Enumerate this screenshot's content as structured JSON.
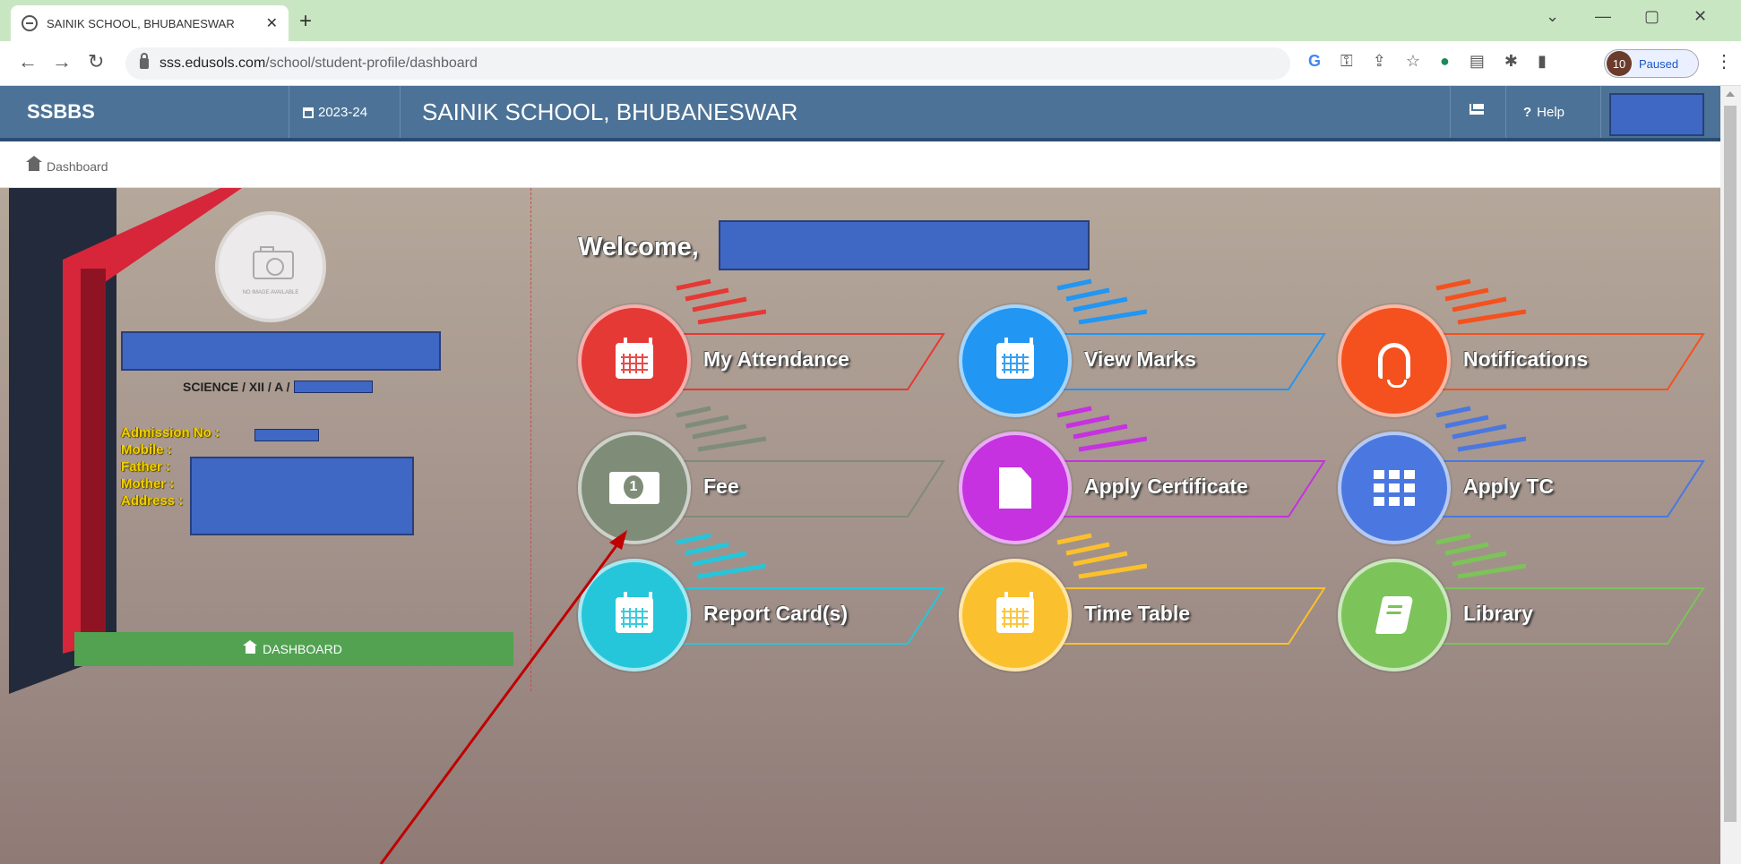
{
  "browser": {
    "tab_title": "SAINIK SCHOOL, BHUBANESWAR",
    "new_tab": "+",
    "url_host": "sss.edusols.com",
    "url_path": "/school/student-profile/dashboard",
    "profile_count": "10",
    "profile_status": "Paused"
  },
  "header": {
    "brand": "SSBBS",
    "session": "2023-24",
    "school_name": "SAINIK SCHOOL, BHUBANESWAR",
    "help": "Help"
  },
  "breadcrumb": {
    "label": "Dashboard"
  },
  "profile": {
    "photo_text": "NO IMAGE AVAILABLE",
    "class_line": "SCIENCE / XII / A /",
    "admission_label": "Admission No :",
    "mobile_label": "Mobile :",
    "father_label": "Father :",
    "mother_label": "Mother :",
    "address_label": "Address :",
    "dashboard_button": "DASHBOARD"
  },
  "welcome": "Welcome,",
  "tiles": [
    {
      "label": "My Attendance",
      "icon": "calendar-icon",
      "color": "#e53935"
    },
    {
      "label": "View Marks",
      "icon": "calendar-icon",
      "color": "#2196f3"
    },
    {
      "label": "Notifications",
      "icon": "bell-icon",
      "color": "#f4511e"
    },
    {
      "label": "Fee",
      "icon": "money-icon",
      "color": "#7f8c78"
    },
    {
      "label": "Apply Certificate",
      "icon": "document-icon",
      "color": "#c631e0"
    },
    {
      "label": "Apply TC",
      "icon": "grid-icon",
      "color": "#4a78e0"
    },
    {
      "label": "Report Card(s)",
      "icon": "calendar-icon",
      "color": "#26c6da"
    },
    {
      "label": "Time Table",
      "icon": "calendar-icon",
      "color": "#fbc02d"
    },
    {
      "label": "Library",
      "icon": "book-icon",
      "color": "#7cc35a"
    }
  ]
}
